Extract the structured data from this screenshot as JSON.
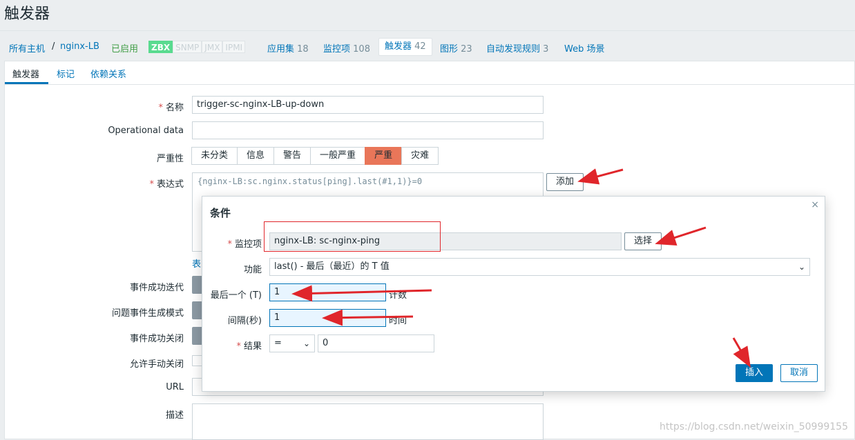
{
  "page": {
    "title": "触发器"
  },
  "breadcrumb": {
    "all_hosts": "所有主机",
    "separator": "/",
    "host": "nginx-LB",
    "status": "已启用",
    "availability": [
      "ZBX",
      "SNMP",
      "JMX",
      "IPMI"
    ],
    "items": [
      {
        "label": "应用集",
        "count": "18"
      },
      {
        "label": "监控项",
        "count": "108"
      },
      {
        "label": "触发器",
        "count": "42"
      },
      {
        "label": "图形",
        "count": "23"
      },
      {
        "label": "自动发现规则",
        "count": "3"
      },
      {
        "label": "Web 场景",
        "count": ""
      }
    ]
  },
  "tabs": [
    "触发器",
    "标记",
    "依赖关系"
  ],
  "form": {
    "name_label": "名称",
    "name_value": "trigger-sc-nginx-LB-up-down",
    "opdata_label": "Operational data",
    "opdata_value": "",
    "severity_label": "严重性",
    "severities": [
      "未分类",
      "信息",
      "警告",
      "一般严重",
      "严重",
      "灾难"
    ],
    "severity_selected": 4,
    "expr_label": "表达式",
    "expr_value": "{nginx-LB:sc.nginx.status[ping].last(#1,1)}=0",
    "add_button": "添加",
    "expr_link": "表",
    "ok_event_label": "事件成功迭代",
    "problem_mode_label": "问题事件生成模式",
    "ok_close_label": "事件成功关闭",
    "manual_close_label": "允许手动关闭",
    "url_label": "URL",
    "desc_label": "描述"
  },
  "dialog": {
    "title": "条件",
    "close": "×",
    "item_label": "监控项",
    "item_value": "nginx-LB: sc-nginx-ping",
    "select_button": "选择",
    "function_label": "功能",
    "function_value": "last() - 最后（最近）的 T 值",
    "last_label": "最后一个 (T)",
    "last_value": "1",
    "last_unit": "计数",
    "interval_label": "间隔(秒)",
    "interval_value": "1",
    "interval_unit": "时间",
    "result_label": "结果",
    "result_op": "=",
    "result_value": "0",
    "insert_button": "插入",
    "cancel_button": "取消"
  },
  "watermark": "https://blog.csdn.net/weixin_50999155",
  "colors": {
    "accent": "#0275b8",
    "severity_high": "#e97659",
    "annotation": "#e0262b",
    "enabled": "#429e47"
  }
}
